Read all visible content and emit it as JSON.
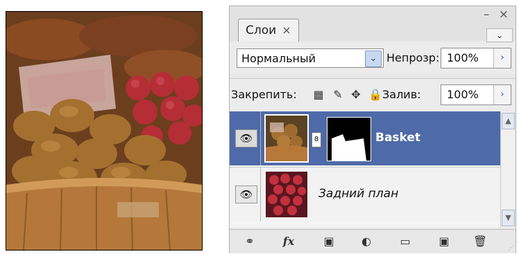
{
  "panel": {
    "tab_label": "Слои",
    "tab_close": "×",
    "window_controls": "– ×",
    "menu_glyph": "▾☰",
    "blend_mode": "Нормальный",
    "opacity_label": "Непрозр:",
    "opacity_value": "100%",
    "lock_label": "Закрепить:",
    "fill_label": "Залив:",
    "fill_value": "100%"
  },
  "layers": [
    {
      "name": "Basket",
      "selected": true,
      "visible": true,
      "has_mask": true
    },
    {
      "name": "Задний план",
      "selected": false,
      "visible": true,
      "has_mask": false
    }
  ],
  "icons": {
    "eye": "eye-icon",
    "link": "link-layers-icon",
    "fx": "fx-icon",
    "mask": "add-mask-icon",
    "adjustment": "adjustment-layer-icon",
    "group": "folder-icon",
    "new_layer": "new-layer-icon",
    "delete": "trash-icon"
  },
  "colors": {
    "selection": "#4f6aa8",
    "panel_bg": "#e8e8e8"
  },
  "glyphs": {
    "eye": "👁",
    "chain": "8",
    "dd": "⌄",
    "arrow": "›",
    "fx": "fx",
    "link": "⚭",
    "adj": "◐",
    "folder": "▭",
    "newlayer": "▣",
    "trash": "🗑",
    "lock_trans": "▦",
    "lock_brush": "✎",
    "lock_move": "✥",
    "lock_all": "🔒",
    "up": "▲",
    "down": "▼",
    "grip": "⋰"
  }
}
